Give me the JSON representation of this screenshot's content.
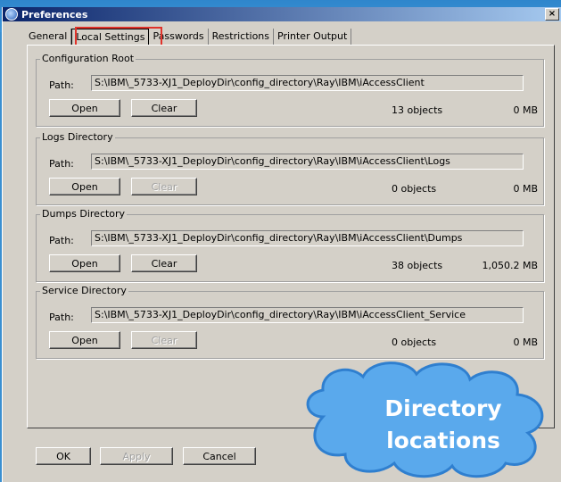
{
  "window": {
    "title": "Preferences",
    "close_glyph": "×"
  },
  "tabs": [
    {
      "label": "General"
    },
    {
      "label": "Local Settings"
    },
    {
      "label": "Passwords"
    },
    {
      "label": "Restrictions"
    },
    {
      "label": "Printer Output"
    }
  ],
  "groups": [
    {
      "title": "Configuration Root",
      "path_label": "Path:",
      "path": "S:\\IBM\\_5733-XJ1_DeployDir\\config_directory\\Ray\\IBM\\iAccessClient",
      "open_label": "Open",
      "clear_label": "Clear",
      "clear_enabled": true,
      "objects": "13 objects",
      "size": "0 MB"
    },
    {
      "title": "Logs Directory",
      "path_label": "Path:",
      "path": "S:\\IBM\\_5733-XJ1_DeployDir\\config_directory\\Ray\\IBM\\iAccessClient\\Logs",
      "open_label": "Open",
      "clear_label": "Clear",
      "clear_enabled": false,
      "objects": "0 objects",
      "size": "0 MB"
    },
    {
      "title": "Dumps Directory",
      "path_label": "Path:",
      "path": "S:\\IBM\\_5733-XJ1_DeployDir\\config_directory\\Ray\\IBM\\iAccessClient\\Dumps",
      "open_label": "Open",
      "clear_label": "Clear",
      "clear_enabled": true,
      "objects": "38 objects",
      "size": "1,050.2 MB"
    },
    {
      "title": "Service Directory",
      "path_label": "Path:",
      "path": "S:\\IBM\\_5733-XJ1_DeployDir\\config_directory\\Ray\\IBM\\iAccessClient_Service",
      "open_label": "Open",
      "clear_label": "Clear",
      "clear_enabled": false,
      "objects": "0 objects",
      "size": "0 MB"
    }
  ],
  "footer": {
    "ok_label": "OK",
    "apply_label": "Apply",
    "cancel_label": "Cancel"
  },
  "callout": {
    "line1": "Directory",
    "line2": "locations"
  },
  "colors": {
    "highlight": "#e0332b",
    "cloud_fill": "#5aa9ec",
    "cloud_stroke": "#2f7fcf",
    "slide_bg": "#3a8fd0"
  }
}
